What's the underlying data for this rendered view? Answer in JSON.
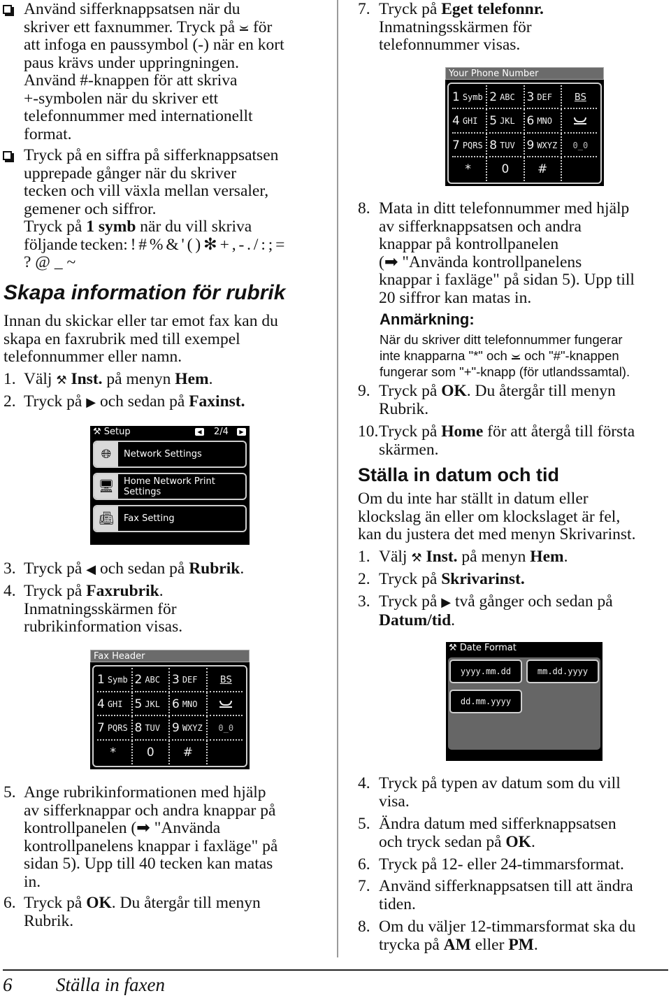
{
  "left_column": {
    "bullet1": {
      "lines": [
        "Använd sifferknappsatsen när du",
        "skriver ett faxnummer. Tryck på ",
        "att infoga en paussymbol (-) när en kort",
        "paus krävs under uppringningen.",
        "Använd #-knappen för att skriva",
        "+-symbolen när du skriver ett",
        "telefonnummer med internationellt",
        "format."
      ],
      "line2_after_icon": " för",
      "pause_icon": "pause-icon"
    },
    "bullet2": {
      "lines": [
        "Tryck på en siffra på sifferknappsatsen",
        "upprepade gånger när du skriver",
        "tecken och vill växla mellan versaler,",
        "gemener och siffror."
      ],
      "symb_prefix": "Tryck på ",
      "symb_bold": "1 symb",
      "symb_suffix": " när du vill skriva",
      "chars_line1": "följande tecken: ! # % & ' ( ) ✻ + , - . / : ; =",
      "chars_line2": "? @ _ ~"
    },
    "section_title": "Skapa information för rubrik",
    "intro": [
      "Innan du skickar eller tar emot fax kan du",
      "skapa en faxrubrik med till exempel",
      "telefonnummer eller namn."
    ],
    "steps_a": [
      {
        "num": "1.",
        "pre": "Välj ",
        "icon": "setup-icon",
        "bold": "Inst.",
        "mid": " på menyn ",
        "bold2": "Hem",
        "post": "."
      },
      {
        "num": "2.",
        "pre": "Tryck på ",
        "icon": "right-arrow-icon",
        "mid": " och sedan på ",
        "bold": "Faxinst."
      }
    ],
    "setup_screen": {
      "title": "Setup",
      "page": "2/4",
      "items": [
        {
          "label": "Network Settings",
          "icon": "globe-icon"
        },
        {
          "label": "Home Network Print Settings",
          "icon": "monitor-icon"
        },
        {
          "label": "Fax Setting",
          "icon": "fax-icon"
        }
      ]
    },
    "steps_b": [
      {
        "num": "3.",
        "pre": "Tryck på ",
        "icon": "left-arrow-icon",
        "mid": " och sedan på ",
        "bold": "Rubrik",
        "post": "."
      },
      {
        "num": "4.",
        "pre": "Tryck på ",
        "bold": "Faxrubrik",
        "post": ".",
        "lines": [
          "Inmatningsskärmen för",
          "rubrikinformation visas."
        ]
      }
    ],
    "fax_header_screen": {
      "title": "Fax Header"
    },
    "steps_c": [
      {
        "num": "5.",
        "lines": [
          "Ange rubrikinformationen med hjälp",
          "av sifferknappar och andra knappar på",
          "kontrollpanelen (➡ \"Använda",
          "kontrollpanelens knappar i faxläge\" på",
          "sidan 5). Upp till 40 tecken kan matas",
          "in."
        ]
      },
      {
        "num": "6.",
        "pre": "Tryck på ",
        "bold": "OK",
        "post": ". Du återgår till menyn",
        "line2": "Rubrik."
      }
    ]
  },
  "keypad": {
    "keys": [
      {
        "main": "1",
        "sub": "Symb"
      },
      {
        "main": "2",
        "sub": "ABC"
      },
      {
        "main": "3",
        "sub": "DEF"
      },
      {
        "main": "BS",
        "sub": "",
        "icon": "backspace-icon"
      },
      {
        "main": "4",
        "sub": "GHI"
      },
      {
        "main": "5",
        "sub": "JKL"
      },
      {
        "main": "6",
        "sub": "MNO"
      },
      {
        "main": "",
        "sub": "",
        "icon": "pause-icon"
      },
      {
        "main": "7",
        "sub": "PQRS"
      },
      {
        "main": "8",
        "sub": "TUV"
      },
      {
        "main": "9",
        "sub": "WXYZ"
      },
      {
        "main": "0_0",
        "sub": "",
        "icon": "space-icon"
      },
      {
        "main": "*",
        "sub": ""
      },
      {
        "main": "0",
        "sub": ""
      },
      {
        "main": "#",
        "sub": ""
      },
      {
        "main": "",
        "sub": ""
      }
    ]
  },
  "right_column": {
    "step7": {
      "num": "7.",
      "pre": "Tryck på ",
      "bold": "Eget telefonnr.",
      "lines": [
        "Inmatningsskärmen för",
        "telefonnummer visas."
      ]
    },
    "phone_screen": {
      "title": "Your Phone Number"
    },
    "step8": {
      "num": "8.",
      "lines": [
        "Mata in ditt telefonnummer med hjälp",
        "av sifferknappsatsen och andra",
        "knappar på kontrollpanelen",
        "(➡ \"Använda kontrollpanelens",
        "knappar i faxläge\" på sidan 5). Upp till",
        "20 siffror kan matas in."
      ]
    },
    "note": {
      "title": "Anmärkning:",
      "line1": "När du skriver ditt telefonnummer fungerar",
      "line2_pre": "inte knapparna \"*\" och ",
      "line2_post": " och \"#\"-knappen",
      "line3": "fungerar som \"+\"-knapp (för utlandssamtal)."
    },
    "step9": {
      "num": "9.",
      "pre": "Tryck på ",
      "bold": "OK",
      "post": ". Du återgår till menyn",
      "line2": "Rubrik."
    },
    "step10": {
      "num": "10.",
      "pre": "Tryck på ",
      "bold": "Home",
      "post": " för att återgå till första",
      "line2": "skärmen."
    },
    "section_title": "Ställa in datum och tid",
    "intro": [
      "Om du inte har ställt in datum eller",
      "klockslag än eller om klockslaget är fel,",
      "kan du justera det med menyn Skrivarinst."
    ],
    "steps_a": [
      {
        "num": "1.",
        "pre": "Välj ",
        "bold": "Inst.",
        "mid": " på menyn ",
        "bold2": "Hem",
        "post": "."
      },
      {
        "num": "2.",
        "pre": "Tryck på ",
        "bold": "Skrivarinst."
      },
      {
        "num": "3.",
        "pre": "Tryck på ",
        "mid": " två gånger och sedan på",
        "bold_line2": "Datum/tid",
        "post": "."
      }
    ],
    "date_screen": {
      "title": "Date Format",
      "options": [
        "yyyy.mm.dd",
        "mm.dd.yyyy",
        "dd.mm.yyyy"
      ]
    },
    "steps_b": [
      {
        "num": "4.",
        "lines": [
          "Tryck på typen av datum som du vill",
          "visa."
        ]
      },
      {
        "num": "5.",
        "line1": "Ändra datum med sifferknappsatsen",
        "pre": "och tryck sedan på ",
        "bold": "OK",
        "post": "."
      },
      {
        "num": "6.",
        "lines": [
          "Tryck på 12- eller 24-timmarsformat."
        ]
      },
      {
        "num": "7.",
        "lines": [
          "Använd sifferknappsatsen till att ändra",
          "tiden."
        ]
      },
      {
        "num": "8.",
        "line1": "Om du väljer 12-timmarsformat ska du",
        "pre": "trycka på ",
        "bold": "AM",
        "mid": " eller ",
        "bold2": "PM",
        "post": "."
      }
    ]
  },
  "footer": {
    "page_number": "6",
    "chapter_title": "Ställa in faxen"
  }
}
